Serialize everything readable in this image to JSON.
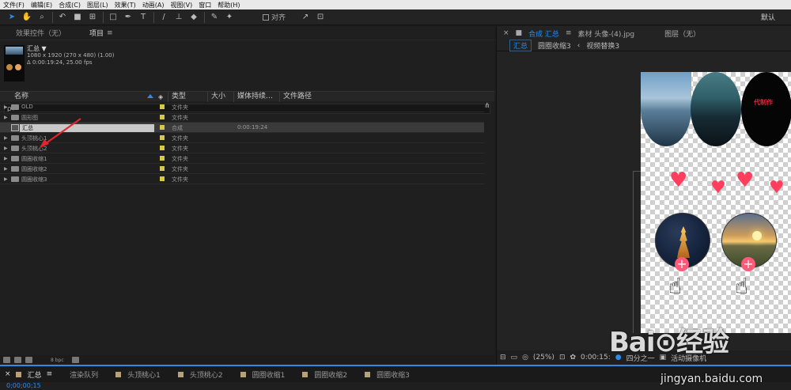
{
  "menu": [
    "文件(F)",
    "编辑(E)",
    "合成(C)",
    "图层(L)",
    "效果(T)",
    "动画(A)",
    "视图(V)",
    "窗口",
    "帮助(H)"
  ],
  "toolbar": {
    "align_label": "对齐",
    "workspace_label": "默认"
  },
  "project_panel": {
    "tabs": [
      "效果控件（无）",
      "项目"
    ],
    "selected_item": {
      "name": "汇总 ▼",
      "line1": "1080 x 1920 (270 x 480) (1.00)",
      "line2": "Δ 0:00:19:24, 25.00 fps"
    },
    "search_placeholder": "⍴▾",
    "columns": [
      "名称",
      "类型",
      "大小",
      "媒体持续…",
      "文件路径"
    ],
    "rows": [
      {
        "name": "OLD",
        "type": "文件夹",
        "duration": "",
        "kind": "folder"
      },
      {
        "name": "圆形图",
        "type": "文件夹",
        "duration": "",
        "kind": "folder"
      },
      {
        "name": "汇总",
        "type": "合成",
        "duration": "0:00:19:24",
        "kind": "comp"
      },
      {
        "name": "头顶桃心1",
        "type": "文件夹",
        "duration": "",
        "kind": "folder"
      },
      {
        "name": "头顶桃心2",
        "type": "文件夹",
        "duration": "",
        "kind": "folder"
      },
      {
        "name": "圆圈收缩1",
        "type": "文件夹",
        "duration": "",
        "kind": "folder"
      },
      {
        "name": "圆圈收缩2",
        "type": "文件夹",
        "duration": "",
        "kind": "folder"
      },
      {
        "name": "圆圈收缩3",
        "type": "文件夹",
        "duration": "",
        "kind": "folder"
      }
    ],
    "bpc_label": "8 bpc"
  },
  "comp_panel": {
    "tabs": [
      "×",
      "合成 汇总",
      "≡",
      "素材 头像-(4).jpg",
      "图层（无）"
    ],
    "breadcrumbs": [
      "汇总",
      "圆圈收缩3",
      "视频替换3"
    ],
    "canvas_text": "代制作",
    "footer": {
      "zoom": "(25%)",
      "timecode": "0:00:15:",
      "quality": "四分之一",
      "camera": "活动摄像机"
    }
  },
  "timeline_tabs": [
    "汇总",
    "渲染队列",
    "头顶桃心1",
    "头顶桃心2",
    "圆圈收缩1",
    "圆圈收缩2",
    "圆圈收缩3"
  ],
  "current_time": "0;00;00;15",
  "watermark": {
    "brand": "Bai⊙经验",
    "url": "jingyan.baidu.com"
  }
}
